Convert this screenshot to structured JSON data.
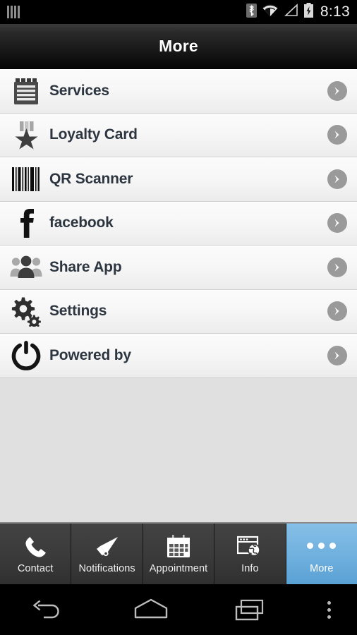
{
  "status_bar": {
    "time": "8:13",
    "icons": [
      "sim-bars-icon",
      "bluetooth-icon",
      "wifi-icon",
      "cellular-signal-icon",
      "battery-charging-icon"
    ]
  },
  "title_bar": {
    "title": "More"
  },
  "menu": {
    "items": [
      {
        "label": "Services",
        "icon": "notepad-icon",
        "chevron": "chevron-right-icon"
      },
      {
        "label": "Loyalty Card",
        "icon": "medal-icon",
        "chevron": "chevron-right-icon"
      },
      {
        "label": "QR Scanner",
        "icon": "barcode-icon",
        "chevron": "chevron-right-icon"
      },
      {
        "label": "facebook",
        "icon": "facebook-icon",
        "chevron": "chevron-right-icon"
      },
      {
        "label": "Share App",
        "icon": "people-icon",
        "chevron": "chevron-right-icon"
      },
      {
        "label": "Settings",
        "icon": "gears-icon",
        "chevron": "chevron-right-icon"
      },
      {
        "label": "Powered by",
        "icon": "power-icon",
        "chevron": "chevron-right-icon"
      }
    ]
  },
  "tab_bar": {
    "active_color": "#6fb0de",
    "tabs": [
      {
        "label": "Contact",
        "icon": "phone-icon",
        "active": false
      },
      {
        "label": "Notifications",
        "icon": "megaphone-icon",
        "active": false
      },
      {
        "label": "Appointment",
        "icon": "calendar-icon",
        "active": false
      },
      {
        "label": "Info",
        "icon": "browser-globe-icon",
        "active": false
      },
      {
        "label": "More",
        "icon": "three-dots-icon",
        "active": true
      }
    ]
  },
  "nav_bar": {
    "buttons": [
      "back-icon",
      "home-icon",
      "recents-icon",
      "overflow-menu-icon"
    ]
  }
}
